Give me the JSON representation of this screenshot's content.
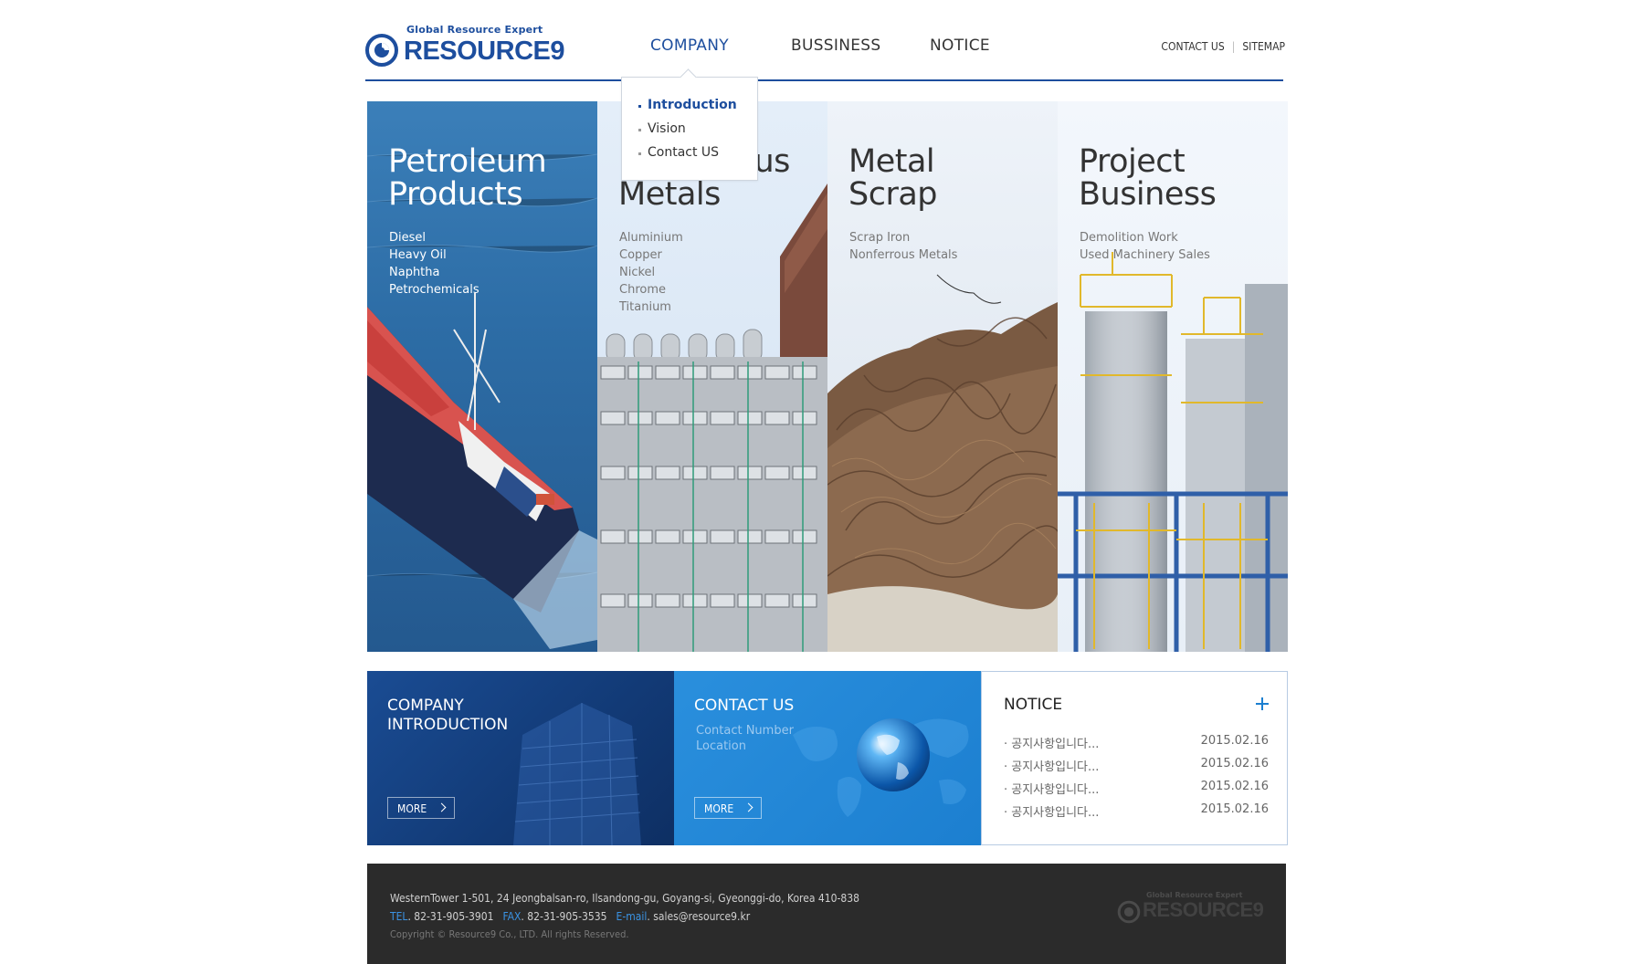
{
  "header": {
    "logo": {
      "tagline": "Global Resource Expert",
      "wordmark": "RESOURCE9"
    },
    "nav": [
      {
        "label": "COMPANY",
        "active": true
      },
      {
        "label": "BUSSINESS",
        "active": false
      },
      {
        "label": "NOTICE",
        "active": false
      }
    ],
    "util_links": [
      "CONTACT US",
      "SITEMAP"
    ],
    "dropdown": [
      {
        "label": "Introduction",
        "active": true
      },
      {
        "label": "Vision",
        "active": false
      },
      {
        "label": "Contact US",
        "active": false
      }
    ]
  },
  "hero": {
    "panels": [
      {
        "title_line1": "Petroleum",
        "title_line2": "Products",
        "items": [
          "Diesel",
          "Heavy Oil",
          "Naphtha",
          "Petrochemicals"
        ],
        "image": "tanker-ship"
      },
      {
        "title_line1": "Nonferrous",
        "title_line2": "Metals",
        "items": [
          "Aluminium",
          "Copper",
          "Nickel",
          "Chrome",
          "Titanium"
        ],
        "image": "aluminium-ingots"
      },
      {
        "title_line1": "Metal",
        "title_line2": "Scrap",
        "items": [
          "Scrap Iron",
          "Nonferrous Metals"
        ],
        "image": "scrap-pile"
      },
      {
        "title_line1": "Project",
        "title_line2": "Business",
        "items": [
          "Demolition Work",
          "Used Machinery Sales"
        ],
        "image": "industrial-plant"
      }
    ]
  },
  "boxes": {
    "intro": {
      "title_line1": "COMPANY",
      "title_line2": "INTRODUCTION",
      "more_label": "MORE"
    },
    "contact": {
      "title": "CONTACT US",
      "links": [
        "Contact Number",
        "Location"
      ],
      "more_label": "MORE"
    },
    "notice": {
      "title": "NOTICE",
      "items": [
        {
          "title": "· 공지사항입니다...",
          "date": "2015.02.16"
        },
        {
          "title": "· 공지사항입니다...",
          "date": "2015.02.16"
        },
        {
          "title": "· 공지사항입니다...",
          "date": "2015.02.16"
        },
        {
          "title": "· 공지사항입니다...",
          "date": "2015.02.16"
        }
      ]
    }
  },
  "footer": {
    "address": "WesternTower 1-501, 24 Jeongbalsan-ro, Ilsandong-gu, Goyang-si, Gyeonggi-do, Korea 410-838",
    "tel_label": "TEL",
    "tel": ". 82-31-905-3901",
    "fax_label": "FAX",
    "fax": ". 82-31-905-3535",
    "email_label": "E-mail",
    "email": ". sales@resource9.kr",
    "copyright": "Copyright © Resource9 Co., LTD. All rights Reserved.",
    "logo": {
      "tagline": "Global Resource Expert",
      "wordmark": "RESOURCE9"
    }
  },
  "colors": {
    "brand": "#1d4e9e",
    "accent": "#1c7fd0",
    "footer_bg": "#2b2b2b"
  }
}
